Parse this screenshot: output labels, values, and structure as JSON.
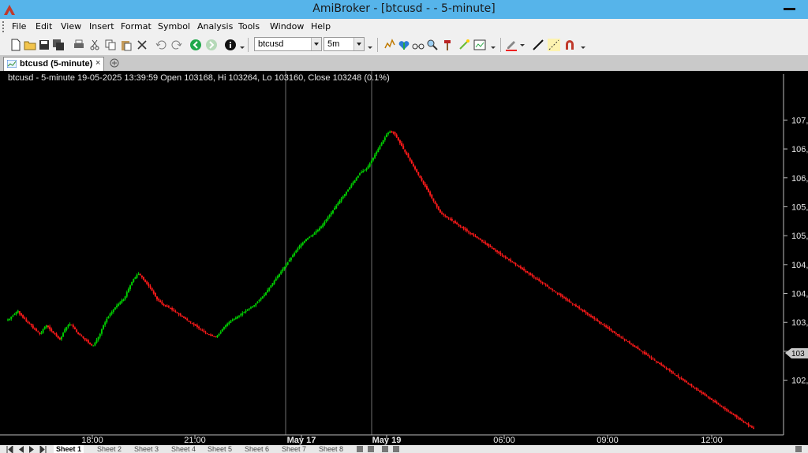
{
  "window": {
    "title": "AmiBroker - [btcusd -  - 5-minute]"
  },
  "menu": {
    "items": [
      "File",
      "Edit",
      "View",
      "Insert",
      "Format",
      "Symbol",
      "Analysis",
      "Tools",
      "Window",
      "Help"
    ]
  },
  "toolbar": {
    "symbol_value": "btcusd",
    "interval_value": "5m"
  },
  "doc_tab": {
    "label": "btcusd (5-minute)",
    "close": "×"
  },
  "chart": {
    "header_text": "btcusd - 5-minute 19-05-2025 13:39:59 Open 103168, Hi 103264, Lo 103160, Close 103248 (0.1%)",
    "price_marker_text": "103",
    "colors": {
      "background": "#000000",
      "up": "#00cc00",
      "down": "#ff1a1a",
      "separator": "#707070",
      "axis_text": "#e6e6e6",
      "marker_bg": "#c8c8c8"
    }
  },
  "chart_data": {
    "type": "candlestick",
    "title": "",
    "y_ticks": [
      "107,",
      "106,",
      "106,",
      "105,",
      "105,",
      "104,",
      "104,",
      "103,",
      "103,",
      "102,"
    ],
    "ylim": [
      101650,
      107550
    ],
    "x_ticks": [
      "18:00",
      "21:00",
      "May 17",
      "May 19",
      "06:00",
      "09:00",
      "12:00"
    ],
    "day_separators": [
      "May 17",
      "May 19"
    ],
    "series": [
      {
        "name": "btcusd",
        "close_path": [
          103550,
          103560,
          103600,
          103620,
          103640,
          103680,
          103700,
          103650,
          103620,
          103580,
          103560,
          103520,
          103490,
          103480,
          103450,
          103400,
          103380,
          103350,
          103330,
          103300,
          103320,
          103380,
          103420,
          103450,
          103420,
          103380,
          103350,
          103320,
          103300,
          103260,
          103230,
          103200,
          103250,
          103320,
          103380,
          103420,
          103450,
          103470,
          103450,
          103420,
          103380,
          103330,
          103300,
          103280,
          103260,
          103230,
          103200,
          103180,
          103150,
          103120,
          103100,
          103100,
          103150,
          103200,
          103250,
          103300,
          103380,
          103450,
          103500,
          103560,
          103600,
          103650,
          103680,
          103720,
          103760,
          103790,
          103820,
          103850,
          103880,
          103900,
          103950,
          104020,
          104080,
          104140,
          104200,
          104250,
          104280,
          104320,
          104340,
          104320,
          104280,
          104240,
          104200,
          104160,
          104130,
          104100,
          104050,
          104000,
          103950,
          103900,
          103880,
          103850,
          103820,
          103800,
          103780,
          103780,
          103760,
          103740,
          103720,
          103700,
          103680,
          103660,
          103640,
          103620,
          103600,
          103580,
          103560,
          103540,
          103520,
          103500,
          103480,
          103460,
          103440,
          103420,
          103400,
          103380,
          103360,
          103340,
          103320,
          103300,
          103290,
          103280,
          103270,
          103260,
          103250,
          103270,
          103300,
          103340,
          103380,
          103420,
          103450,
          103480,
          103500,
          103520,
          103540,
          103560,
          103580,
          103600,
          103620,
          103640,
          103660,
          103680,
          103700,
          103720,
          103740,
          103760,
          103780,
          103800,
          103830,
          103860,
          103890,
          103920,
          103950,
          103980,
          104020,
          104060,
          104100,
          104140,
          104180,
          104220,
          104260,
          104300,
          104340,
          104380,
          104420,
          104460,
          104500,
          104540,
          104580,
          104620,
          104660,
          104700,
          104740,
          104780,
          104820,
          104850,
          104880,
          104910,
          104940,
          104960,
          104980,
          105000,
          105020,
          105050,
          105080,
          105100,
          105130,
          105160,
          105200,
          105240,
          105280,
          105320,
          105360,
          105400,
          105440,
          105480,
          105520,
          105560,
          105600,
          105640,
          105680,
          105720,
          105760,
          105800,
          105840,
          105880,
          105920,
          105960,
          106000,
          106040,
          106080,
          106100,
          106120,
          106140,
          106160,
          106200,
          106250,
          106300,
          106350,
          106400,
          106450,
          106500,
          106550,
          106600,
          106650,
          106700,
          106750,
          106780,
          106800,
          106800,
          106780,
          106750,
          106700,
          106650,
          106600,
          106550,
          106500,
          106450,
          106400,
          106350,
          106300,
          106250,
          106200,
          106150,
          106100,
          106050,
          106000,
          105950,
          105900,
          105850,
          105800,
          105750,
          105700,
          105650,
          105600,
          105550,
          105500,
          105450,
          105400,
          105380,
          105360,
          105340,
          105320,
          105300,
          105280,
          105260,
          105240,
          105220,
          105200,
          105180,
          105160,
          105140,
          105120,
          105100,
          105080,
          105060,
          105040,
          105020,
          105000,
          104980,
          104960,
          104940,
          104920,
          104900,
          104880,
          104860,
          104840,
          104820,
          104800,
          104780,
          104760,
          104740,
          104720,
          104700,
          104680,
          104660,
          104640,
          104620,
          104600,
          104580,
          104560,
          104540,
          104520,
          104500,
          104480,
          104460,
          104440,
          104420,
          104400,
          104380,
          104360,
          104340,
          104320,
          104300,
          104280,
          104260,
          104240,
          104220,
          104200,
          104180,
          104160,
          104140,
          104120,
          104100,
          104080,
          104060,
          104040,
          104020,
          104000,
          103980,
          103960,
          103940,
          103920,
          103900,
          103880,
          103860,
          103840,
          103820,
          103800,
          103780,
          103760,
          103740,
          103720,
          103700,
          103680,
          103660,
          103640,
          103620,
          103600,
          103580,
          103560,
          103540,
          103520,
          103500,
          103480,
          103460,
          103440,
          103420,
          103400,
          103380,
          103360,
          103340,
          103320,
          103300,
          103280,
          103260,
          103240,
          103220,
          103200,
          103180,
          103160,
          103140,
          103120,
          103100,
          103080,
          103060,
          103040,
          103020,
          103000,
          102980,
          102960,
          102940,
          102920,
          102900,
          102880,
          102860,
          102840,
          102820,
          102800,
          102780,
          102760,
          102740,
          102720,
          102700,
          102680,
          102660,
          102640,
          102620,
          102600,
          102580,
          102560,
          102540,
          102520,
          102500,
          102480,
          102460,
          102440,
          102420,
          102400,
          102380,
          102360,
          102340,
          102320,
          102300,
          102280,
          102260,
          102240,
          102220,
          102200,
          102180,
          102160,
          102140,
          102120,
          102100,
          102080,
          102060,
          102040,
          102020,
          102000,
          101980,
          101960,
          101940,
          101920,
          101900,
          101880,
          101860,
          101840,
          101820,
          101800,
          101780,
          101760,
          101740,
          101720,
          101700,
          101680,
          101660
        ]
      }
    ]
  },
  "sheets": {
    "tabs": [
      "Sheet 1",
      "Sheet 2",
      "Sheet 3",
      "Sheet 4",
      "Sheet 5",
      "Sheet 6",
      "Sheet 7",
      "Sheet 8"
    ]
  }
}
